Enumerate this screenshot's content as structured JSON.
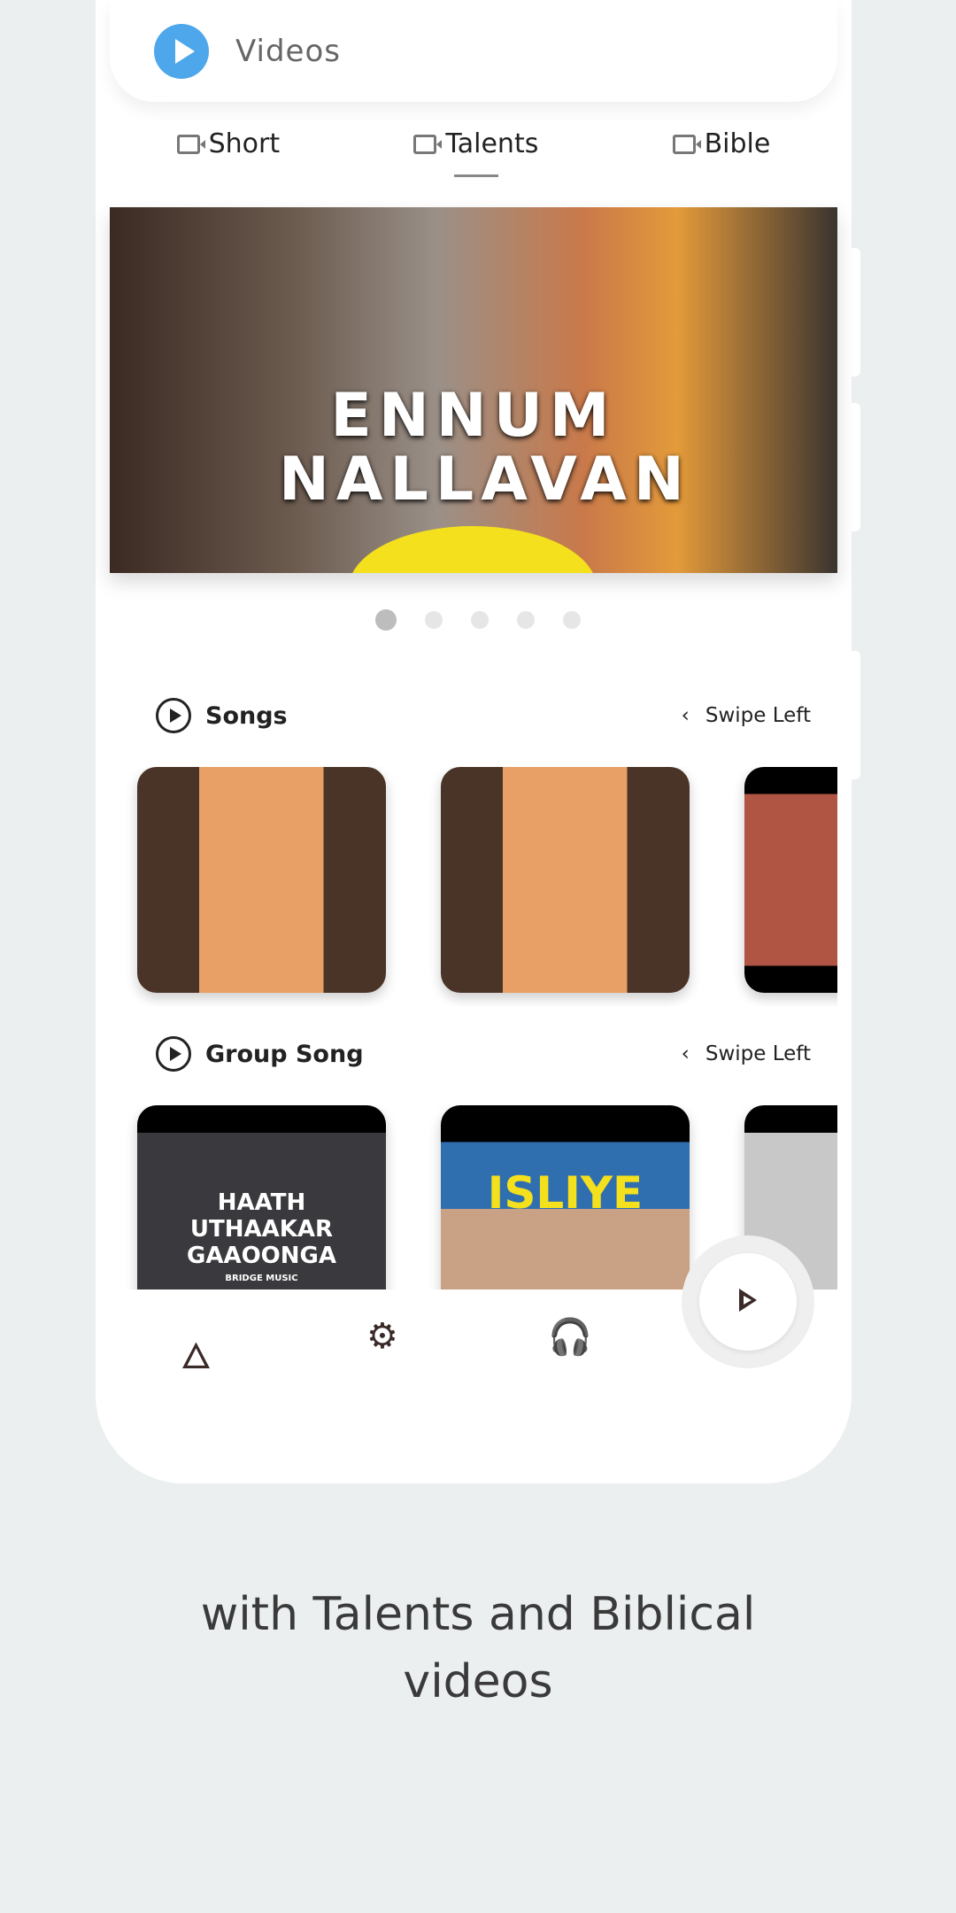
{
  "header": {
    "title": "Videos",
    "icon": "play-circle-icon",
    "accent": "#4ea7ea"
  },
  "tabs": [
    {
      "label": "Short"
    },
    {
      "label": "Talents",
      "active": true
    },
    {
      "label": "Bible"
    }
  ],
  "banner": {
    "title": "ENNUM NALLAVAN",
    "slides": 5,
    "active_slide": 1
  },
  "sections": [
    {
      "title": "Songs",
      "hint": "Swipe Left"
    },
    {
      "title": "Group Song",
      "hint": "Swipe Left",
      "thumb_texts": [
        "HAATH UTHAAKAR GAAOONGA",
        "BRIDGE MUSIC",
        "ISLIYE"
      ]
    }
  ],
  "nav": {
    "items": [
      "fire-icon",
      "head-gear-icon",
      "headphones-icon"
    ],
    "fab": "play-icon"
  },
  "caption": {
    "line1": "with Talents and Biblical",
    "line2": "videos"
  }
}
